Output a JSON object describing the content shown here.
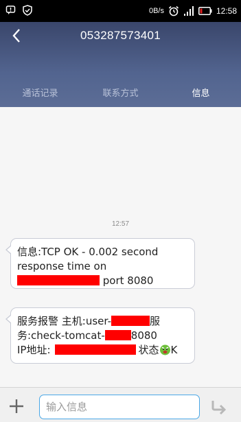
{
  "status_bar": {
    "network_speed": "0B/s",
    "time": "12:58",
    "icons": [
      "notification-icon",
      "shield-icon",
      "alarm-icon",
      "signal-icon",
      "battery-icon"
    ]
  },
  "header": {
    "title": "053287573401",
    "back_icon": "back-arrow-icon",
    "tabs": [
      {
        "label": "通话记录",
        "active": false
      },
      {
        "label": "联系方式",
        "active": false
      },
      {
        "label": "信息",
        "active": true
      }
    ]
  },
  "conversation": {
    "timestamp": "12:57",
    "messages": [
      {
        "line1": "信息:TCP OK - 0.002 second",
        "line2": "response time on",
        "line3_suffix": "port 8080"
      },
      {
        "line1_prefix": "服务报警 主机:user-",
        "line1_suffix": "服",
        "line2_prefix": "务:check-tomcat-",
        "line2_suffix": "8080",
        "line3_prefix": "IP地址:",
        "line3_mid": "状态",
        "line3_suffix": "K"
      }
    ]
  },
  "input_bar": {
    "placeholder": "输入信息",
    "value": "",
    "add_icon": "plus-icon",
    "send_icon": "send-icon"
  },
  "colors": {
    "header_bg": "#4a5a82",
    "accent": "#49a7e6",
    "redaction": "#ff0000"
  }
}
